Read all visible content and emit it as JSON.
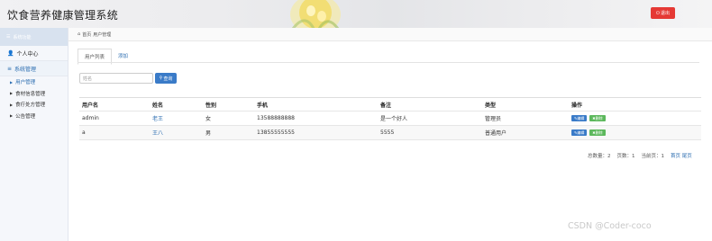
{
  "header": {
    "title": "饮食营养健康管理系统",
    "logout_label": "退出"
  },
  "sidebar": {
    "top_label": "系统功能",
    "sections": [
      {
        "label": "个人中心"
      },
      {
        "label": "系统管理"
      }
    ],
    "items": [
      {
        "label": "用户管理"
      },
      {
        "label": "食材信息管理"
      },
      {
        "label": "食疗处方管理"
      },
      {
        "label": "公告管理"
      }
    ]
  },
  "breadcrumb": {
    "home": "首页",
    "current": "用户管理"
  },
  "tabs": [
    {
      "label": "用户列表"
    },
    {
      "label": "添加"
    }
  ],
  "search": {
    "placeholder": "姓名",
    "button_label": "查询"
  },
  "table": {
    "headers": [
      "用户名",
      "姓名",
      "性别",
      "手机",
      "备注",
      "类型",
      "操作"
    ],
    "rows": [
      {
        "username": "admin",
        "name": "老王",
        "gender": "女",
        "phone": "13588888888",
        "note": "是一个好人",
        "type": "管理员"
      },
      {
        "username": "a",
        "name": "王八",
        "gender": "男",
        "phone": "13855555555",
        "note": "5555",
        "type": "普通用户"
      }
    ],
    "edit_label": "编辑",
    "delete_label": "删除"
  },
  "pager": {
    "total": "总数量：2",
    "pages": "页数：1",
    "current": "当前页：1",
    "first": "首页",
    "last": "尾页"
  },
  "watermark": "CSDN @Coder-coco"
}
